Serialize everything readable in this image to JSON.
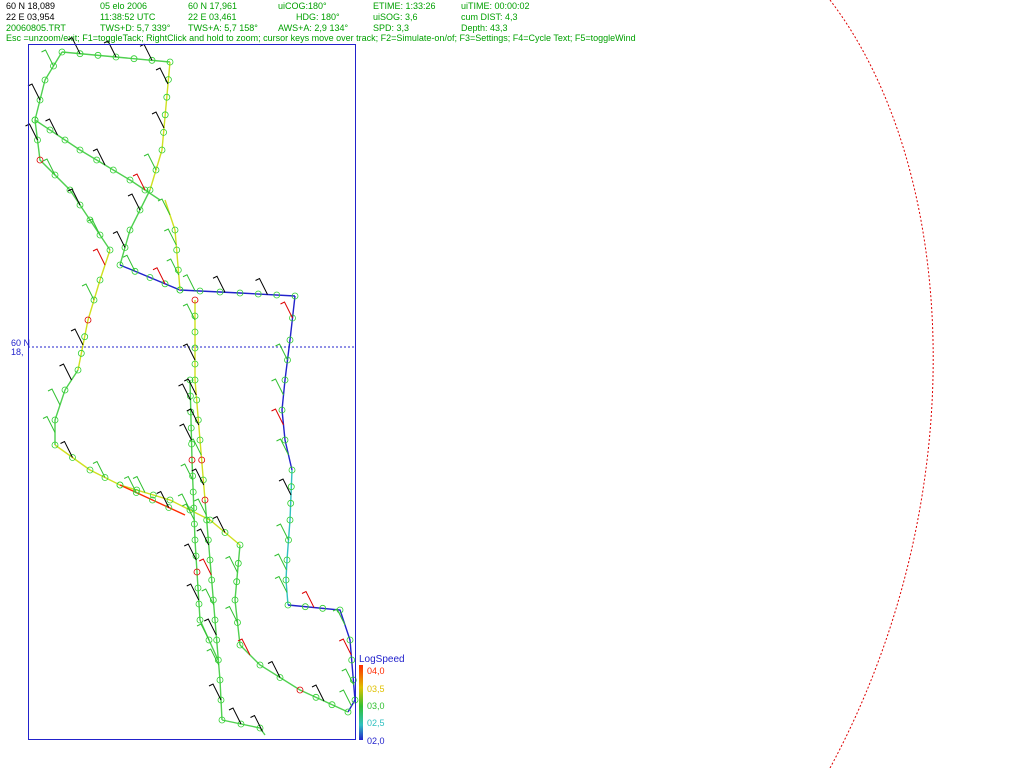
{
  "header": {
    "row1": {
      "lat": "60 N 18,089",
      "date": "05 elo 2006",
      "lat2": "60 N 17,961",
      "uicog": "uiCOG:180°",
      "etime": "ETIME: 1:33:26",
      "uitime": "uiTIME: 00:00:02"
    },
    "row2": {
      "lon": "22 E 03,954",
      "time": "11:38:52  UTC",
      "lon2": "22 E 03,461",
      "hdg": "HDG: 180°",
      "uisog": "uiSOG: 3,6",
      "cumdist": "cum DIST: 4,3"
    },
    "row3": {
      "file": "20060805.TRT",
      "twsd": "TWS+D: 5,7 339°",
      "twsa": "TWS+A: 5,7 158°",
      "awsa": "AWS+A: 2,9 134°",
      "spd": "SPD: 3,3",
      "depth": "Depth: 43,3"
    },
    "hint": "Esc =unzoom/exit; F1=toggleTack; RightClick and hold to zoom; cursor keys move over track; F2=Simulate-on/of; F3=Settings; F4=Cycle Text; F5=toggleWind"
  },
  "plot": {
    "lat_label_1": "60 N",
    "lat_label_2": "18,",
    "frame_color": "#2222cc",
    "gridline_color": "#2222cc",
    "circle_color": "#dd0000"
  },
  "legend": {
    "title": "LogSpeed",
    "ticks": [
      "04,0",
      "03,5",
      "03,0",
      "02,5",
      "02,0"
    ],
    "tick_colors": [
      "#ff2a00",
      "#e0c000",
      "#30c030",
      "#30c0c0",
      "#2222cc"
    ]
  },
  "track": {
    "speed_colors": {
      "slow": "#2222cc",
      "medium_slow": "#30c0c0",
      "medium": "#50d050",
      "medium_fast": "#d0e020",
      "fast": "#ff2a00"
    },
    "marker_color": "#30d030",
    "wind_barb_colors": [
      "#000000",
      "#30c030",
      "#dd0000"
    ]
  }
}
